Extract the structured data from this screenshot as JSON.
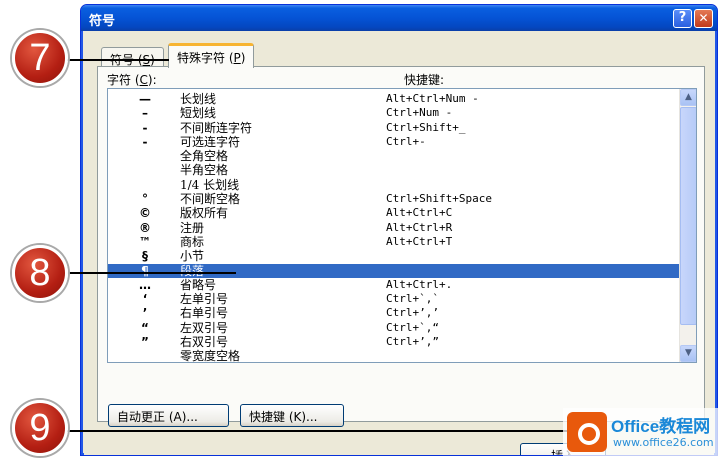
{
  "window": {
    "title": "符号",
    "help_glyph": "?",
    "close_glyph": "✕"
  },
  "tabs": [
    {
      "label": "符号 (S)",
      "text": "符号 (",
      "key": "S",
      "suffix": ")"
    },
    {
      "label": "特殊字符 (P)",
      "text": "特殊字符 (",
      "key": "P",
      "suffix": ")",
      "active": true
    }
  ],
  "columns": {
    "char_text": "字符 (",
    "char_key": "C",
    "char_suffix": "):",
    "shortcut": "快捷键:"
  },
  "rows": [
    {
      "glyph": "—",
      "name": "长划线",
      "key": "Alt+Ctrl+Num -"
    },
    {
      "glyph": "–",
      "name": "短划线",
      "key": "Ctrl+Num -"
    },
    {
      "glyph": "-",
      "name": "不间断连字符",
      "key": "Ctrl+Shift+_"
    },
    {
      "glyph": "-",
      "name": "可选连字符",
      "key": "Ctrl+-"
    },
    {
      "glyph": "",
      "name": "全角空格",
      "key": ""
    },
    {
      "glyph": "",
      "name": "半角空格",
      "key": ""
    },
    {
      "glyph": "",
      "name": "1/4 长划线",
      "key": ""
    },
    {
      "glyph": "°",
      "name": "不间断空格",
      "key": "Ctrl+Shift+Space"
    },
    {
      "glyph": "©",
      "name": "版权所有",
      "key": "Alt+Ctrl+C"
    },
    {
      "glyph": "®",
      "name": "注册",
      "key": "Alt+Ctrl+R"
    },
    {
      "glyph": "™",
      "name": "商标",
      "key": "Alt+Ctrl+T"
    },
    {
      "glyph": "§",
      "name": "小节",
      "key": ""
    },
    {
      "glyph": "¶",
      "name": "段落",
      "key": "",
      "selected": true
    },
    {
      "glyph": "…",
      "name": "省略号",
      "key": "Alt+Ctrl+."
    },
    {
      "glyph": "‘",
      "name": "左单引号",
      "key": "Ctrl+`,`"
    },
    {
      "glyph": "’",
      "name": "右单引号",
      "key": "Ctrl+’,’"
    },
    {
      "glyph": "“",
      "name": "左双引号",
      "key": "Ctrl+`,“"
    },
    {
      "glyph": "”",
      "name": "右双引号",
      "key": "Ctrl+’,”"
    },
    {
      "glyph": "",
      "name": "零宽度空格",
      "key": ""
    }
  ],
  "buttons": {
    "autocorrect": "自动更正 (A)...",
    "shortcut": "快捷键 (K)...",
    "insert": "插入"
  },
  "callouts": [
    "7",
    "8",
    "9"
  ],
  "watermark": {
    "text": "Office教程网",
    "url": "www.office26.com"
  },
  "colors": {
    "selection": "#316ac5",
    "titlebar": "#0553d5",
    "callout": "#b41f13"
  }
}
